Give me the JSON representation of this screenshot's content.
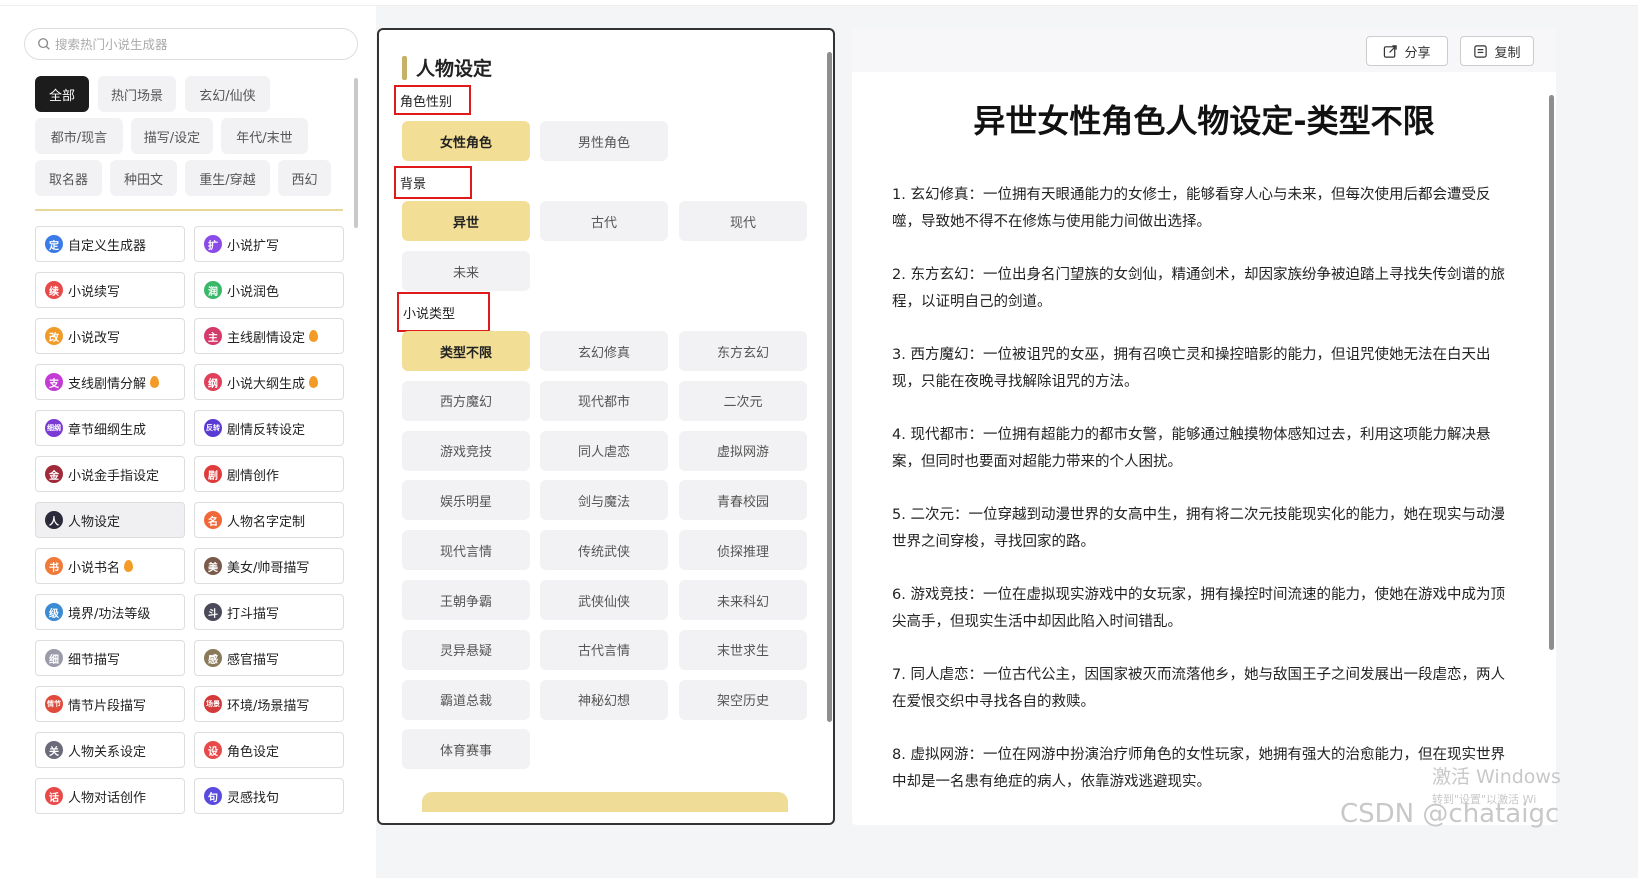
{
  "search": {
    "placeholder": "搜索热门小说生成器"
  },
  "categories": [
    "全部",
    "热门场景",
    "玄幻/仙侠",
    "都市/现言",
    "描写/设定",
    "年代/末世",
    "取名器",
    "种田文",
    "重生/穿越",
    "西幻"
  ],
  "tools": [
    {
      "label": "自定义生成器",
      "icon": "custom-generator-icon",
      "glyph": "定",
      "color": "#3a7be8",
      "hot": false
    },
    {
      "label": "小说扩写",
      "icon": "expand-icon",
      "glyph": "扩",
      "color": "#8a4be8",
      "hot": false
    },
    {
      "label": "小说续写",
      "icon": "continue-icon",
      "glyph": "续",
      "color": "#e84a4a",
      "hot": false
    },
    {
      "label": "小说润色",
      "icon": "polish-icon",
      "glyph": "润",
      "color": "#3ab86a",
      "hot": false
    },
    {
      "label": "小说改写",
      "icon": "rewrite-icon",
      "glyph": "改",
      "color": "#f09a28",
      "hot": false
    },
    {
      "label": "主线剧情设定",
      "icon": "main-plot-icon",
      "glyph": "主",
      "color": "#d43a6a",
      "hot": true
    },
    {
      "label": "支线剧情分解",
      "icon": "subplot-icon",
      "glyph": "支",
      "color": "#c43ad4",
      "hot": true
    },
    {
      "label": "小说大纲生成",
      "icon": "outline-icon",
      "glyph": "纲",
      "color": "#e0405a",
      "hot": true
    },
    {
      "label": "章节细纲生成",
      "icon": "chapter-outline-icon",
      "glyph": "细纲",
      "color": "#7a3ad4",
      "hot": false
    },
    {
      "label": "剧情反转设定",
      "icon": "plot-twist-icon",
      "glyph": "反转",
      "color": "#5a3ad4",
      "hot": false
    },
    {
      "label": "小说金手指设定",
      "icon": "golden-finger-icon",
      "glyph": "金",
      "color": "#a02a3a",
      "hot": false
    },
    {
      "label": "剧情创作",
      "icon": "plot-creation-icon",
      "glyph": "剧",
      "color": "#e03a3a",
      "hot": false
    },
    {
      "label": "人物设定",
      "icon": "character-avatar-icon",
      "glyph": "人",
      "color": "#2a2a3a",
      "hot": false
    },
    {
      "label": "人物名字定制",
      "icon": "character-name-icon",
      "glyph": "名",
      "color": "#f0683a",
      "hot": false
    },
    {
      "label": "小说书名",
      "icon": "book-title-icon",
      "glyph": "书",
      "color": "#f07a3a",
      "hot": true
    },
    {
      "label": "美女/帅哥描写",
      "icon": "portrait-icon",
      "glyph": "美",
      "color": "#7a5a4a",
      "hot": false
    },
    {
      "label": "境界/功法等级",
      "icon": "realm-level-icon",
      "glyph": "级",
      "color": "#3a8ad4",
      "hot": false
    },
    {
      "label": "打斗描写",
      "icon": "fight-icon",
      "glyph": "斗",
      "color": "#4a4a5a",
      "hot": false
    },
    {
      "label": "细节描写",
      "icon": "magnifier-icon",
      "glyph": "细",
      "color": "#9a9aaa",
      "hot": false
    },
    {
      "label": "感官描写",
      "icon": "senses-icon",
      "glyph": "感",
      "color": "#8a7a5a",
      "hot": false
    },
    {
      "label": "情节片段描写",
      "icon": "plot-fragment-icon",
      "glyph": "情节",
      "color": "#e04a3a",
      "hot": false
    },
    {
      "label": "环境/场景描写",
      "icon": "scene-icon",
      "glyph": "场景",
      "color": "#d43a3a",
      "hot": false
    },
    {
      "label": "人物关系设定",
      "icon": "relationship-icon",
      "glyph": "关",
      "color": "#6a6a7a",
      "hot": false
    },
    {
      "label": "角色设定",
      "icon": "role-setting-icon",
      "glyph": "设",
      "color": "#e84a4a",
      "hot": false
    },
    {
      "label": "人物对话创作",
      "icon": "dialogue-icon",
      "glyph": "话",
      "color": "#e84a4a",
      "hot": false
    },
    {
      "label": "灵感找句",
      "icon": "inspiration-icon",
      "glyph": "句",
      "color": "#5a4ae0",
      "hot": false
    }
  ],
  "middle": {
    "title": "人物设定",
    "gender_label": "角色性别",
    "gender_options": [
      "女性角色",
      "男性角色"
    ],
    "background_label": "背景",
    "background_options": [
      "异世",
      "古代",
      "现代",
      "未来"
    ],
    "genre_label": "小说类型",
    "genre_options": [
      "类型不限",
      "玄幻修真",
      "东方玄幻",
      "西方魔幻",
      "现代都市",
      "二次元",
      "游戏竞技",
      "同人虐恋",
      "虚拟网游",
      "娱乐明星",
      "剑与魔法",
      "青春校园",
      "现代言情",
      "传统武侠",
      "侦探推理",
      "王朝争霸",
      "武侠仙侠",
      "未来科幻",
      "灵异悬疑",
      "古代言情",
      "末世求生",
      "霸道总裁",
      "神秘幻想",
      "架空历史",
      "体育赛事"
    ]
  },
  "result": {
    "share_label": "分享",
    "copy_label": "复制",
    "title": "异世女性角色人物设定-类型不限",
    "items": [
      "1. 玄幻修真：一位拥有天眼通能力的女修士，能够看穿人心与未来，但每次使用后都会遭受反噬，导致她不得不在修炼与使用能力间做出选择。",
      "2. 东方玄幻：一位出身名门望族的女剑仙，精通剑术，却因家族纷争被迫踏上寻找失传剑谱的旅程，以证明自己的剑道。",
      "3. 西方魔幻：一位被诅咒的女巫，拥有召唤亡灵和操控暗影的能力，但诅咒使她无法在白天出现，只能在夜晚寻找解除诅咒的方法。",
      "4. 现代都市：一位拥有超能力的都市女警，能够通过触摸物体感知过去，利用这项能力解决悬案，但同时也要面对超能力带来的个人困扰。",
      "5. 二次元：一位穿越到动漫世界的女高中生，拥有将二次元技能现实化的能力，她在现实与动漫世界之间穿梭，寻找回家的路。",
      "6. 游戏竞技：一位在虚拟现实游戏中的女玩家，拥有操控时间流速的能力，使她在游戏中成为顶尖高手，但现实生活中却因此陷入时间错乱。",
      "7. 同人虐恋：一位古代公主，因国家被灭而流落他乡，她与敌国王子之间发展出一段虐恋，两人在爱恨交织中寻找各自的救赎。",
      "8. 虚拟网游：一位在网游中扮演治疗师角色的女性玩家，她拥有强大的治愈能力，但在现实世界中却是一名患有绝症的病人，依靠游戏逃避现实。"
    ]
  },
  "watermark": {
    "line1": "激活 Windows",
    "line2": "转到\"设置\"以激活 Wi",
    "csdn": "CSDN @chataigc"
  },
  "colors": {
    "accent": "#f2df95",
    "active_chip": "#1c1c1c",
    "highlight_box": "#e0191a"
  }
}
